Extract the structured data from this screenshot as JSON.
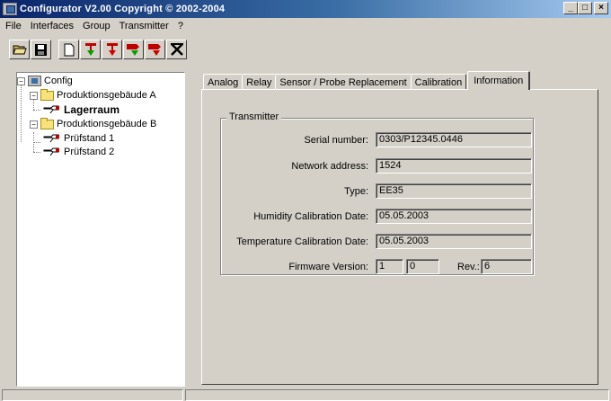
{
  "window": {
    "title": "Configurator  V2.00 Copyright © 2002-2004",
    "minimize_label": "_",
    "maximize_label": "□",
    "close_label": "×",
    "title_gradient_start": "#0a246a",
    "title_gradient_end": "#a6caf0"
  },
  "menu": {
    "items": [
      "File",
      "Interfaces",
      "Group",
      "Transmitter",
      "?"
    ]
  },
  "toolbar": {
    "buttons": [
      "open-folder-icon",
      "save-disk-icon",
      "new-document-icon",
      "read-transmitter-icon",
      "write-transmitter-icon",
      "read-group-icon",
      "write-group-icon",
      "delete-icon"
    ]
  },
  "tree": {
    "root": "Config",
    "groups": [
      {
        "label": "Produktionsgebäude A",
        "children": [
          "Lagerraum"
        ]
      },
      {
        "label": "Produktionsgebäude B",
        "children": [
          "Prüfstand 1",
          "Prüfstand 2"
        ]
      }
    ],
    "selected": "Lagerraum"
  },
  "tabs": [
    "Analog",
    "Relay",
    "Sensor / Probe Replacement",
    "Calibration",
    "Information"
  ],
  "active_tab": "Information",
  "transmitter": {
    "group_title": "Transmitter",
    "serial_label": "Serial number:",
    "serial_value": "0303/P12345.0446",
    "network_label": "Network address:",
    "network_value": "1524",
    "type_label": "Type:",
    "type_value": "EE35",
    "hum_cal_label": "Humidity Calibration Date:",
    "hum_cal_value": "05.05.2003",
    "temp_cal_label": "Temperature Calibration Date:",
    "temp_cal_value": "05.05.2003",
    "fw_label": "Firmware Version:",
    "fw_major": "1",
    "fw_minor": "0",
    "rev_label": "Rev.:",
    "rev_value": "6"
  }
}
